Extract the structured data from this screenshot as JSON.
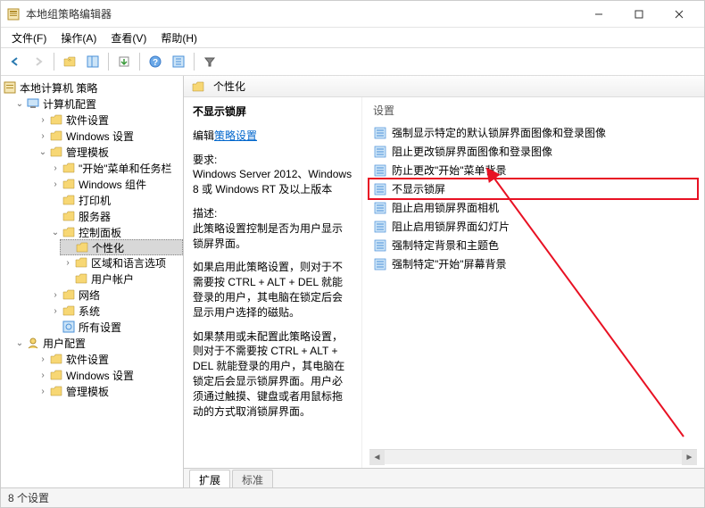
{
  "window": {
    "title": "本地组策略编辑器"
  },
  "menubar": {
    "file": "文件(F)",
    "action": "操作(A)",
    "view": "查看(V)",
    "help": "帮助(H)"
  },
  "tree": {
    "root": "本地计算机 策略",
    "computer": "计算机配置",
    "software": "软件设置",
    "windows_settings": "Windows 设置",
    "admin_templates": "管理模板",
    "start_taskbar": "\"开始\"菜单和任务栏",
    "windows_components": "Windows 组件",
    "printers": "打印机",
    "servers": "服务器",
    "control_panel": "控制面板",
    "personalization": "个性化",
    "region_lang": "区域和语言选项",
    "user_accounts": "用户帐户",
    "network": "网络",
    "system": "系统",
    "all_settings": "所有设置",
    "user": "用户配置",
    "u_software": "软件设置",
    "u_windows": "Windows 设置",
    "u_admin": "管理模板"
  },
  "detail": {
    "header": "个性化",
    "selected": "不显示锁屏",
    "edit_prefix": "编辑",
    "edit_link": "策略设置",
    "req_label": "要求:",
    "req_text": "Windows Server 2012、Windows 8 或 Windows RT 及以上版本",
    "desc_label": "描述:",
    "desc_text1": "此策略设置控制是否为用户显示锁屏界面。",
    "desc_text2": "如果启用此策略设置，则对于不需要按 CTRL + ALT + DEL 就能登录的用户，其电脑在锁定后会显示用户选择的磁贴。",
    "desc_text3": "如果禁用或未配置此策略设置，则对于不需要按 CTRL + ALT + DEL 就能登录的用户，其电脑在锁定后会显示锁屏界面。用户必须通过触摸、键盘或者用鼠标拖动的方式取消锁屏界面。",
    "col_header": "设置",
    "items": [
      "强制显示特定的默认锁屏界面图像和登录图像",
      "阻止更改锁屏界面图像和登录图像",
      "防止更改\"开始\"菜单背景",
      "不显示锁屏",
      "阻止启用锁屏界面相机",
      "阻止启用锁屏界面幻灯片",
      "强制特定背景和主题色",
      "强制特定\"开始\"屏幕背景"
    ],
    "highlighted_index": 3
  },
  "tabs": {
    "extended": "扩展",
    "standard": "标准"
  },
  "statusbar": {
    "text": "8 个设置"
  }
}
